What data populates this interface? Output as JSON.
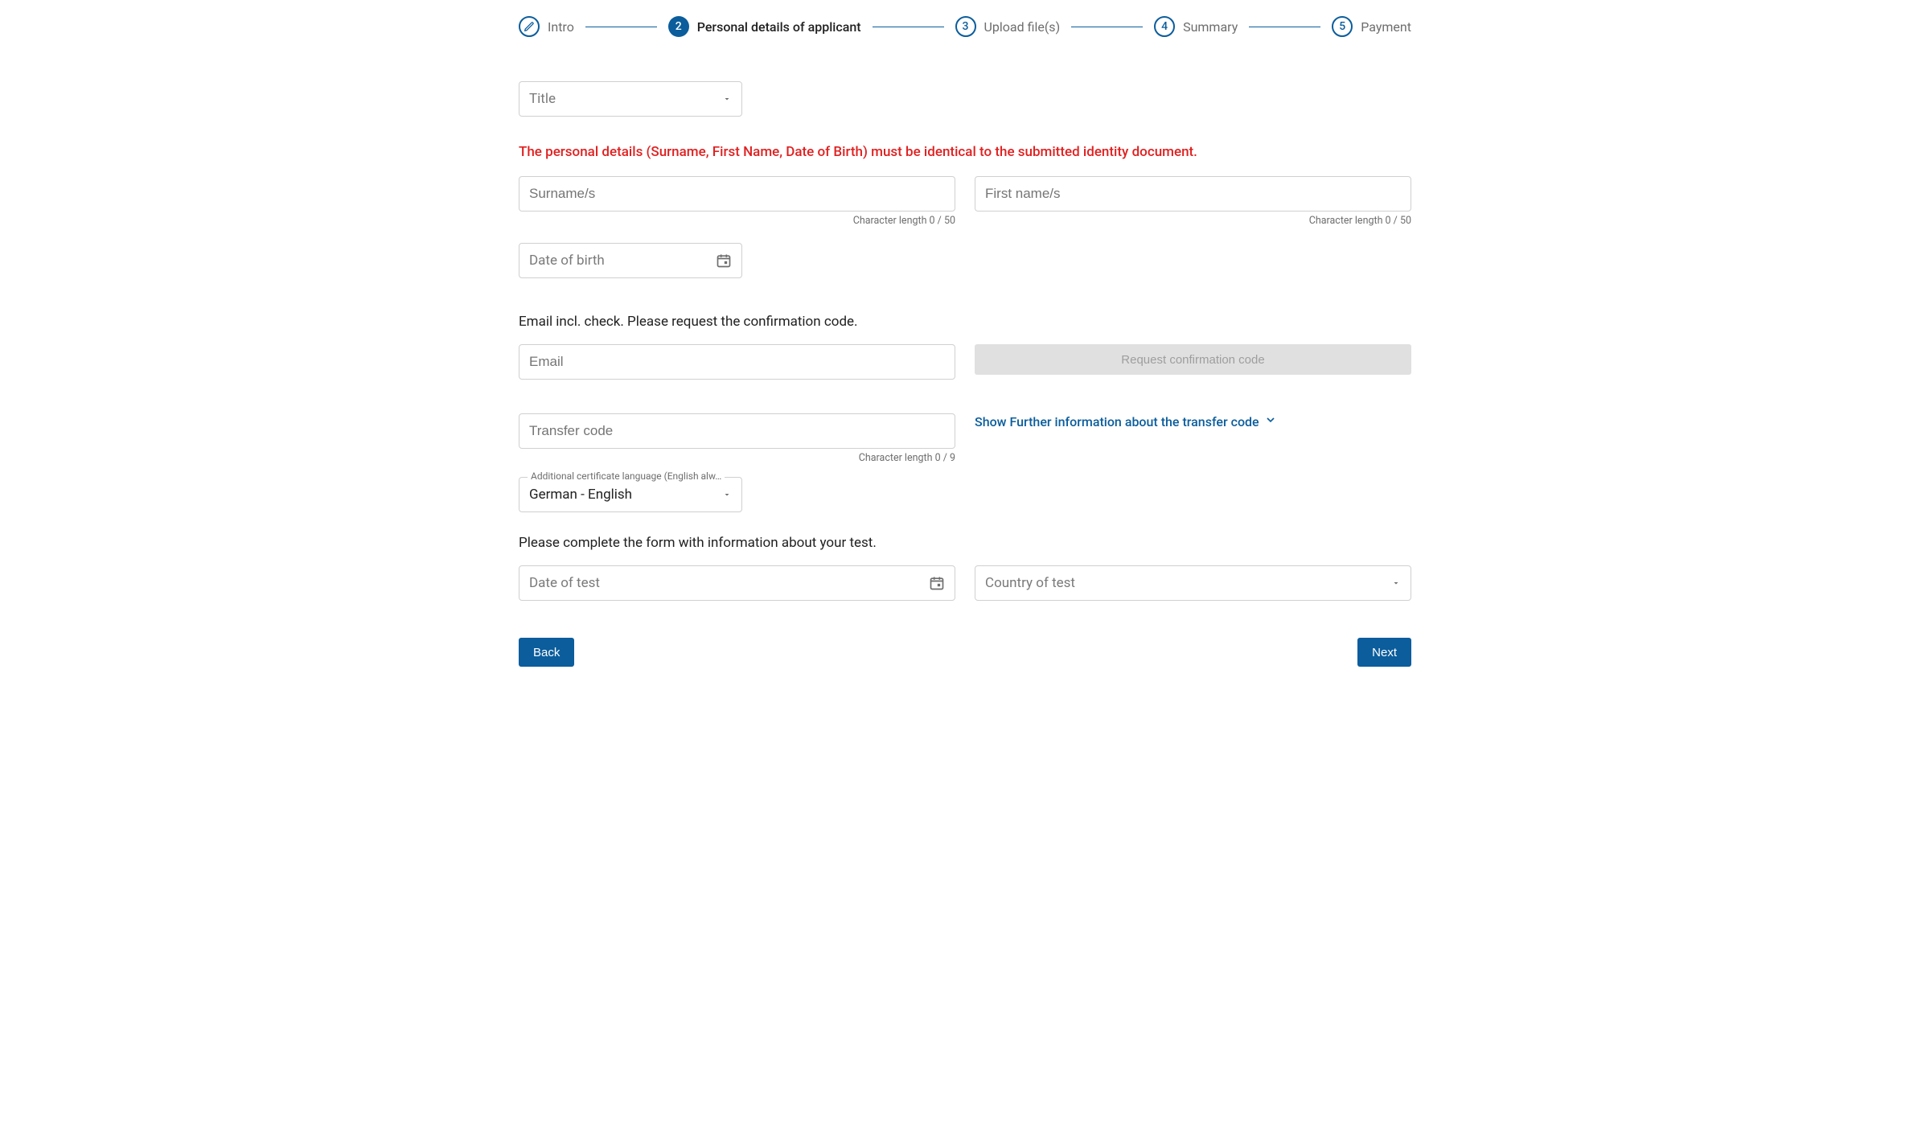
{
  "stepper": {
    "steps": [
      {
        "number": "",
        "label": "Intro"
      },
      {
        "number": "2",
        "label": "Personal details of applicant"
      },
      {
        "number": "3",
        "label": "Upload file(s)"
      },
      {
        "number": "4",
        "label": "Summary"
      },
      {
        "number": "5",
        "label": "Payment"
      }
    ]
  },
  "form": {
    "title_label": "Title",
    "warning": "The personal details (Surname, First Name, Date of Birth) must be identical to the submitted identity document.",
    "surname_label": "Surname/s",
    "surname_helper": "Character length 0 / 50",
    "firstname_label": "First name/s",
    "firstname_helper": "Character length 0 / 50",
    "dob_label": "Date of birth",
    "email_section": "Email incl. check. Please request the confirmation code.",
    "email_label": "Email",
    "request_code_btn": "Request confirmation code",
    "transfer_code_label": "Transfer code",
    "transfer_code_helper": "Character length 0 / 9",
    "transfer_info_link": "Show Further information about the transfer code",
    "cert_lang_float": "Additional certificate language (English alw…",
    "cert_lang_value": "German - English",
    "test_section": "Please complete the form with information about your test.",
    "date_of_test_label": "Date of test",
    "country_of_test_label": "Country of test"
  },
  "nav": {
    "back": "Back",
    "next": "Next"
  }
}
